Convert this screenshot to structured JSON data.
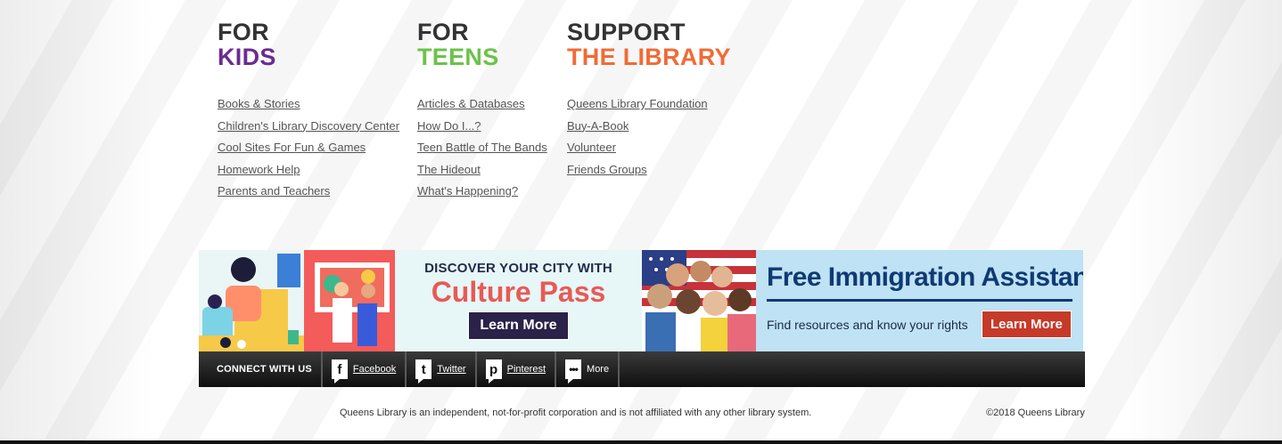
{
  "kids": {
    "heading_1": "FOR",
    "heading_2": "KIDS",
    "accent": "#6a2c91",
    "links": [
      "Books & Stories",
      "Children's Library Discovery Center",
      "Cool Sites For Fun & Games",
      "Homework Help",
      "Parents and Teachers"
    ]
  },
  "teens": {
    "heading_1": "FOR",
    "heading_2": "TEENS",
    "accent": "#6cc24a",
    "links": [
      "Articles & Databases",
      "How Do I...?",
      "Teen Battle of The Bands",
      "The Hideout",
      "What's Happening?"
    ]
  },
  "support": {
    "heading_1": "SUPPORT",
    "heading_2": "THE LIBRARY",
    "accent": "#f06b36",
    "links": [
      "Queens Library Foundation",
      "Buy-A-Book",
      "Volunteer",
      "Friends Groups"
    ]
  },
  "culture_banner": {
    "kicker": "DISCOVER YOUR CITY WITH",
    "title": "Culture Pass",
    "button": "Learn More"
  },
  "immigration_banner": {
    "title": "Free Immigration Assistance",
    "subtitle": "Find resources and know your rights",
    "button": "Learn More"
  },
  "connect": {
    "label": "CONNECT WITH US",
    "items": [
      {
        "label": "Facebook",
        "icon": "facebook-icon"
      },
      {
        "label": "Twitter",
        "icon": "twitter-icon"
      },
      {
        "label": "Pinterest",
        "icon": "pinterest-icon"
      },
      {
        "label": "More",
        "icon": "more-icon"
      }
    ]
  },
  "footer": {
    "note": "Queens Library is an independent, not-for-profit corporation and is not affiliated with any other library system.",
    "copyright": "©2018 Queens Library"
  }
}
